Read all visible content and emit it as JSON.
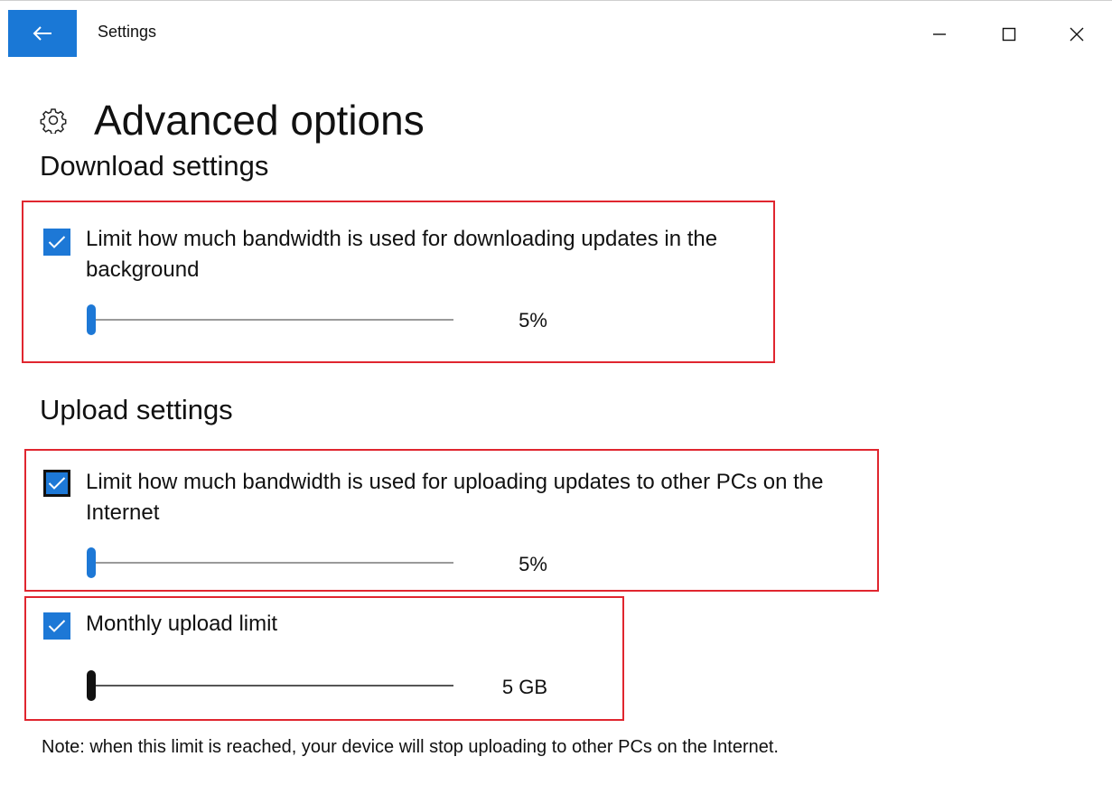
{
  "window": {
    "app_title": "Settings",
    "controls": {
      "minimize_icon": "minimize-icon",
      "maximize_icon": "maximize-icon",
      "close_icon": "close-icon"
    }
  },
  "header": {
    "icon": "gear-icon",
    "title": "Advanced options"
  },
  "download_settings": {
    "heading": "Download settings",
    "limit_bandwidth": {
      "checked": true,
      "label": "Limit how much bandwidth is used for downloading updates in the background",
      "slider_value_text": "5%",
      "slider_fraction": 0.0
    }
  },
  "upload_settings": {
    "heading": "Upload settings",
    "limit_bandwidth": {
      "checked": true,
      "label": "Limit how much bandwidth is used for uploading updates to other PCs on the Internet",
      "slider_value_text": "5%",
      "slider_fraction": 0.0
    },
    "monthly_limit": {
      "checked": true,
      "label": "Monthly upload limit",
      "slider_value_text": "5 GB",
      "slider_fraction": 0.0
    },
    "note": "Note: when this limit is reached, your device will stop uploading to other PCs on the Internet."
  },
  "colors": {
    "accent": "#1d78d6",
    "highlight_box": "#e0262f"
  }
}
